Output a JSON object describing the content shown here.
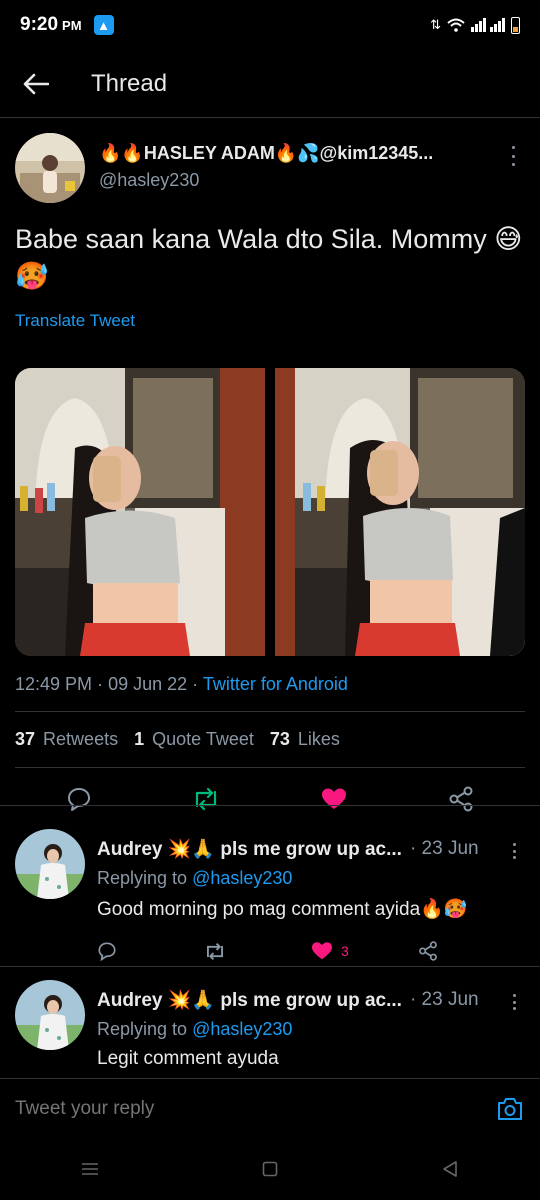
{
  "status_bar": {
    "time": "9:20",
    "ampm": "PM"
  },
  "header": {
    "title": "Thread"
  },
  "tweet": {
    "author_name": "🔥🔥HASLEY ADAM🔥💦@kim12345...",
    "handle": "@hasley230",
    "text": "Babe saan kana  Wala dto Sila. Mommy 😅🥵",
    "translate_label": "Translate Tweet",
    "time": "12:49 PM",
    "date": "09 Jun 22",
    "source": "Twitter for Android",
    "stats": {
      "retweets_count": "37",
      "retweets_label": "Retweets",
      "quotes_count": "1",
      "quotes_label": "Quote Tweet",
      "likes_count": "73",
      "likes_label": "Likes"
    }
  },
  "replies": [
    {
      "name": "Audrey 💥🙏 pls me grow up ac...",
      "date": "· 23 Jun",
      "replying_prefix": "Replying to",
      "mention": "@hasley230",
      "text": "Good morning po mag comment ayida🔥🥵",
      "like_count": "3"
    },
    {
      "name": "Audrey 💥🙏 pls me grow up ac...",
      "date": "· 23 Jun",
      "replying_prefix": "Replying to",
      "mention": "@hasley230",
      "text": "Legit comment ayuda"
    }
  ],
  "compose": {
    "placeholder": "Tweet your reply"
  },
  "colors": {
    "accent": "#1d9bf0",
    "like": "#f91880",
    "retweet": "#00ba7c",
    "muted": "#8b98a5"
  }
}
